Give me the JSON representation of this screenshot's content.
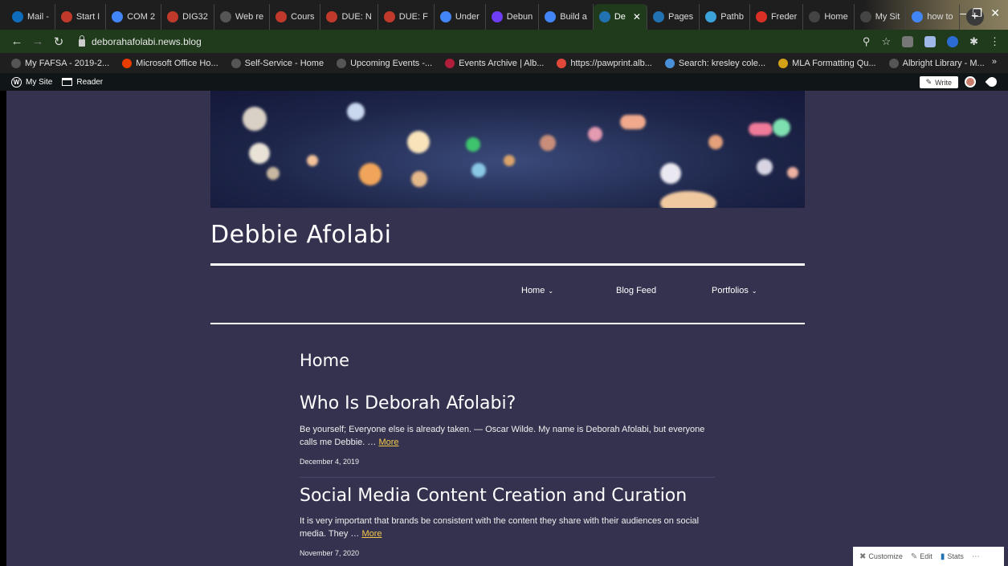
{
  "browser": {
    "tabs": [
      {
        "label": "Mail - ",
        "icon": "outlook-icon",
        "color": "#0f6cbd"
      },
      {
        "label": "Start I",
        "icon": "albright-icon",
        "color": "#c0392b"
      },
      {
        "label": "COM 2",
        "icon": "docs-icon",
        "color": "#4285f4"
      },
      {
        "label": "DIG32",
        "icon": "albright-icon",
        "color": "#c0392b"
      },
      {
        "label": "Web re",
        "icon": "globe-icon",
        "color": "#555555"
      },
      {
        "label": "Cours",
        "icon": "albright-icon",
        "color": "#c0392b"
      },
      {
        "label": "DUE: N",
        "icon": "albright-icon",
        "color": "#c0392b"
      },
      {
        "label": "DUE: F",
        "icon": "albright-icon",
        "color": "#c0392b"
      },
      {
        "label": "Under",
        "icon": "google-icon",
        "color": "#4285f4"
      },
      {
        "label": "Debun",
        "icon": "d-icon",
        "color": "#6f3df5"
      },
      {
        "label": "Build a",
        "icon": "google-icon",
        "color": "#4285f4"
      },
      {
        "label": "De",
        "icon": "wordpress-icon",
        "color": "#2271b1",
        "active": true
      },
      {
        "label": "Pages",
        "icon": "wordpress-icon",
        "color": "#2271b1"
      },
      {
        "label": "Pathb",
        "icon": "pathbrite-icon",
        "color": "#3ba3d9"
      },
      {
        "label": "Freder",
        "icon": "m-icon",
        "color": "#d93025"
      },
      {
        "label": "Home",
        "icon": "wix-icon",
        "color": "#444444"
      },
      {
        "label": "My Sit",
        "icon": "wix-icon",
        "color": "#444444"
      },
      {
        "label": "how to",
        "icon": "google-icon",
        "color": "#4285f4"
      }
    ],
    "url": "deborahafolabi.news.blog",
    "bookmarks": [
      {
        "label": "My FAFSA - 2019-2...",
        "color": "#555555"
      },
      {
        "label": "Microsoft Office Ho...",
        "color": "#eb3c00"
      },
      {
        "label": "Self-Service - Home",
        "color": "#555555"
      },
      {
        "label": "Upcoming Events -...",
        "color": "#555555"
      },
      {
        "label": "Events Archive | Alb...",
        "color": "#b01e3c"
      },
      {
        "label": "https://pawprint.alb...",
        "color": "#e0483a"
      },
      {
        "label": "Search: kresley cole...",
        "color": "#4a90d9"
      },
      {
        "label": "MLA Formatting Qu...",
        "color": "#d4a017"
      },
      {
        "label": "Albright Library - M...",
        "color": "#555555"
      }
    ]
  },
  "admin_bar": {
    "my_site": "My Site",
    "reader": "Reader",
    "write": "Write"
  },
  "site": {
    "title": "Debbie Afolabi",
    "menu": {
      "home": "Home",
      "blog_feed": "Blog Feed",
      "portfolios": "Portfolios"
    },
    "page_heading": "Home",
    "posts": [
      {
        "title": "Who Is Deborah Afolabi?",
        "excerpt": "Be yourself; Everyone else is already taken. — Oscar Wilde. My name is Deborah Afolabi, but everyone calls me Debbie. …",
        "more": "More",
        "date": "December 4, 2019"
      },
      {
        "title": "Social Media Content Creation and Curation",
        "excerpt": "It is very important that brands be consistent with the content they share with their audiences on social media. They …",
        "more": "More",
        "date": "November 7, 2020"
      }
    ]
  },
  "customize_bar": {
    "customize": "Customize",
    "edit": "Edit",
    "stats": "Stats"
  }
}
